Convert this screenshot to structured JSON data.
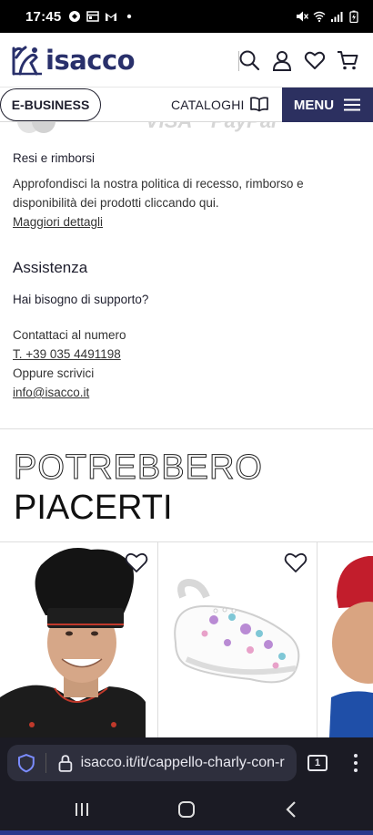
{
  "status_bar": {
    "time": "17:45",
    "left_icons": [
      "notification-icon",
      "calendar-icon",
      "gmail-icon",
      "dot-icon"
    ],
    "right_icons": [
      "mute-icon",
      "wifi-icon",
      "signal-icon",
      "battery-icon"
    ]
  },
  "header": {
    "logo_text": "isacco",
    "icons": [
      "search-icon",
      "account-icon",
      "wishlist-icon",
      "cart-icon"
    ]
  },
  "nav": {
    "ebusiness_label": "E-BUSINESS",
    "cataloghi_label": "CATALOGHI",
    "menu_label": "MENU"
  },
  "payments": [
    "VISA",
    "PayPal"
  ],
  "returns": {
    "title": "Resi e rimborsi",
    "body": "Approfondisci la nostra politica di recesso, rimborso e disponibilità dei prodotti cliccando qui.",
    "link": "Maggiori dettagli"
  },
  "support": {
    "title": "Assistenza",
    "subtitle": "Hai bisogno di supporto?",
    "contact_intro": "Contattaci al numero",
    "phone": "T. +39 035 4491198",
    "write_intro": "Oppure scrivici",
    "email": "info@isacco.it"
  },
  "suggestions": {
    "title_line1": "POTREBBERO",
    "title_line2": "PIACERTI",
    "products": [
      {
        "name": "chef-hat",
        "image": "chef-hat-image"
      },
      {
        "name": "clogs",
        "image": "clogs-image"
      },
      {
        "name": "red-cap",
        "image": "red-cap-image"
      }
    ]
  },
  "browser": {
    "url": "isacco.it/it/cappello-charly-con-r",
    "tab_count": "1"
  },
  "colors": {
    "brand_navy": "#2c3060",
    "browser_bg": "#1b1b24"
  }
}
